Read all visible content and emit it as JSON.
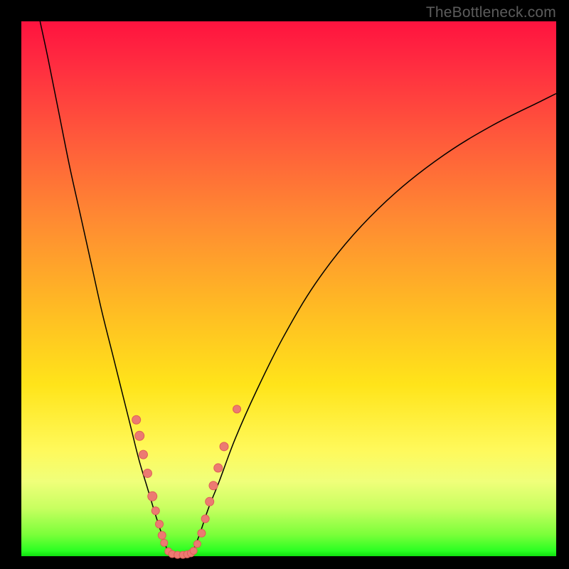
{
  "watermark": "TheBottleneck.com",
  "chart_data": {
    "type": "line",
    "title": "",
    "xlabel": "",
    "ylabel": "",
    "xlim": [
      0,
      100
    ],
    "ylim": [
      0,
      100
    ],
    "background_gradient": {
      "stops": [
        {
          "pos": 0,
          "color": "#ff133f"
        },
        {
          "pos": 8,
          "color": "#ff2c40"
        },
        {
          "pos": 22,
          "color": "#ff5a3b"
        },
        {
          "pos": 37,
          "color": "#ff8a32"
        },
        {
          "pos": 53,
          "color": "#ffb924"
        },
        {
          "pos": 68,
          "color": "#ffe41a"
        },
        {
          "pos": 80,
          "color": "#fff95a"
        },
        {
          "pos": 86,
          "color": "#f0ff7a"
        },
        {
          "pos": 91,
          "color": "#c8ff60"
        },
        {
          "pos": 96,
          "color": "#7aff3a"
        },
        {
          "pos": 99,
          "color": "#2aff22"
        },
        {
          "pos": 100,
          "color": "#10e010"
        }
      ]
    },
    "series": [
      {
        "name": "left-branch",
        "x": [
          3.5,
          5,
          7,
          9,
          11,
          13,
          15,
          17,
          19,
          20.5,
          22,
          23.5,
          25,
          26.3,
          27.5
        ],
        "y": [
          100,
          93,
          83,
          73,
          64,
          55,
          46,
          38,
          30,
          24,
          18,
          13,
          8,
          4,
          0.5
        ]
      },
      {
        "name": "valley",
        "x": [
          27.5,
          28.3,
          29,
          29.7,
          30.4,
          31.1,
          31.9
        ],
        "y": [
          0.5,
          0.1,
          0.05,
          0.05,
          0.05,
          0.1,
          0.5
        ]
      },
      {
        "name": "right-branch",
        "x": [
          31.9,
          33.3,
          35,
          37,
          40,
          44,
          49,
          55,
          62,
          70,
          79,
          88,
          97,
          100
        ],
        "y": [
          0.5,
          4,
          9,
          14,
          22,
          31,
          41,
          51,
          60,
          68,
          75,
          80.5,
          85,
          86.5
        ]
      }
    ],
    "points": {
      "name": "data-points",
      "color": "#ec7a72",
      "xy": [
        [
          21.5,
          25.5,
          6
        ],
        [
          22.1,
          22.5,
          6.5
        ],
        [
          22.8,
          19.0,
          6
        ],
        [
          23.6,
          15.5,
          6
        ],
        [
          24.5,
          11.2,
          6.5
        ],
        [
          25.1,
          8.5,
          5.5
        ],
        [
          25.8,
          6.0,
          5.5
        ],
        [
          26.3,
          3.9,
          5.5
        ],
        [
          26.7,
          2.5,
          5
        ],
        [
          27.5,
          0.9,
          5
        ],
        [
          28.2,
          0.4,
          5
        ],
        [
          29.2,
          0.25,
          5
        ],
        [
          30.2,
          0.25,
          5
        ],
        [
          31.0,
          0.35,
          5
        ],
        [
          31.7,
          0.55,
          5
        ],
        [
          32.2,
          1.0,
          5
        ],
        [
          32.9,
          2.3,
          5
        ],
        [
          33.7,
          4.3,
          5.5
        ],
        [
          34.4,
          7.0,
          5.5
        ],
        [
          35.2,
          10.2,
          6
        ],
        [
          35.9,
          13.2,
          6
        ],
        [
          36.8,
          16.5,
          6
        ],
        [
          37.9,
          20.5,
          6
        ],
        [
          40.3,
          27.5,
          5.5
        ]
      ]
    }
  }
}
